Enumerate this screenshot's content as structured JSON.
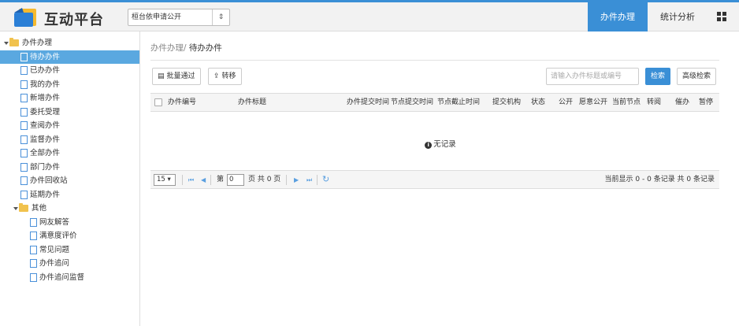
{
  "header": {
    "app_title": "互动平台",
    "dept_select": "桓台依申请公开",
    "nav_tabs": [
      {
        "label": "办件办理",
        "active": true
      },
      {
        "label": "统计分析",
        "active": false
      }
    ],
    "accent_color": "#3a8fd6"
  },
  "sidebar": {
    "root_label": "办件办理",
    "items": [
      "待办办件",
      "已办办件",
      "我的办件",
      "新增办件",
      "委托受理",
      "查阅办件",
      "监督办件",
      "全部办件",
      "部门办件",
      "办件回收站",
      "延期办件"
    ],
    "selected_index": 0,
    "other_label": "其他",
    "other_items": [
      "网友解答",
      "满意度评价",
      "常见问题",
      "办件追问",
      "办件追问监督"
    ]
  },
  "main": {
    "breadcrumb_parent": "办件办理/",
    "breadcrumb_current": "待办办件",
    "batch_button": "批量通过",
    "transfer_button": "转移",
    "search_placeholder": "请输入办件标题或编号",
    "search_button": "检索",
    "advanced_search_button": "高级检索",
    "columns": [
      "办件编号",
      "办件标题",
      "办件提交时间",
      "节点提交时间",
      "节点截止时间",
      "提交机构",
      "状态",
      "公开",
      "愿意公开",
      "当前节点",
      "转阅",
      "催办",
      "暂停"
    ],
    "empty_text": "无记录"
  },
  "pager": {
    "page_size": "15",
    "page_prefix": "第",
    "page_value": "0",
    "page_suffix": "页 共 0 页",
    "info": "当前显示 0 - 0 条记录 共 0 条记录"
  }
}
